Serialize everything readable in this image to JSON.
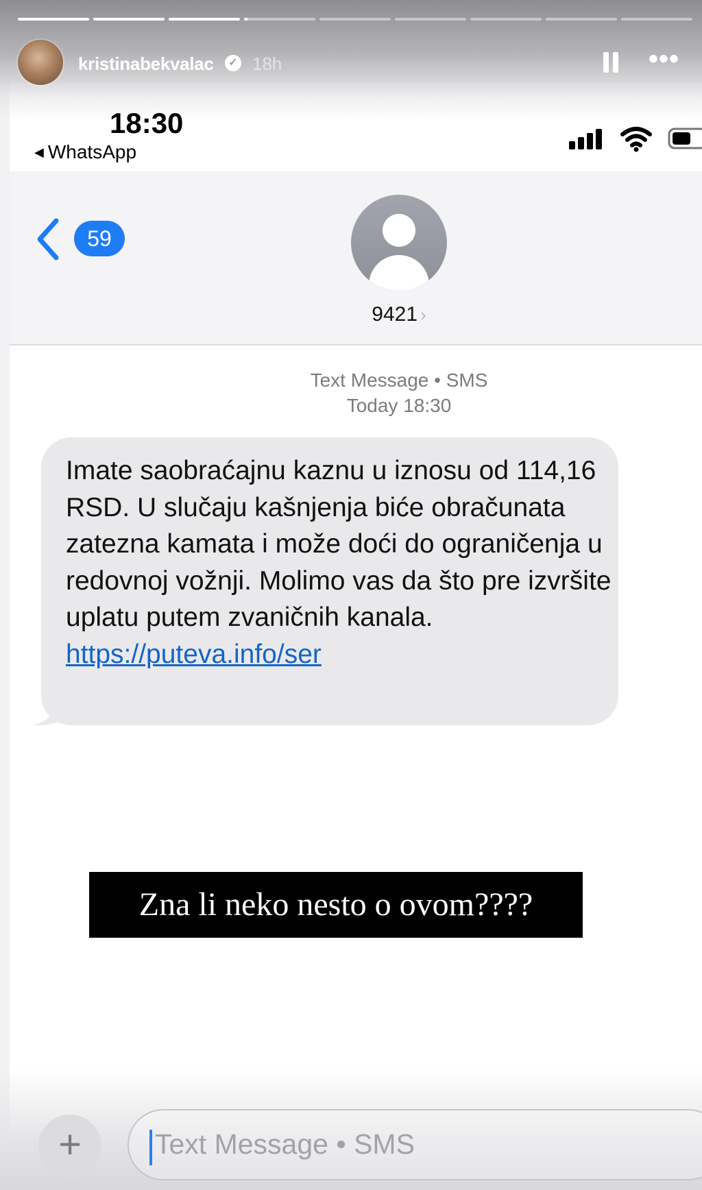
{
  "story": {
    "progress": [
      1,
      1,
      1,
      0.05,
      0,
      0,
      0,
      0,
      0
    ],
    "username": "kristinabekvalac",
    "time_ago": "18h"
  },
  "status_bar": {
    "time": "18:30",
    "back_app": "WhatsApp"
  },
  "nav": {
    "unread_count": "59",
    "contact": "9421"
  },
  "conversation": {
    "service": "Text Message • SMS",
    "timestamp": "Today 18:30",
    "message_text": "Imate saobraćajnu kaznu u iznosu od 114,16 RSD. U slučaju kašnjenja biće obračunata zatezna kamata i može doći do ograničenja u redovnoj vožnji. Molimo vas da što pre izvršite uplatu putem zvaničnih kanala. ",
    "message_link": "https://puteva.info/ser"
  },
  "overlay_caption": "Zna li neko nesto o ovom????",
  "composer": {
    "add_label": "+",
    "placeholder": "Text Message • SMS"
  },
  "colors": {
    "accent": "#1e7cf4",
    "bubble": "#e9e9eb",
    "link": "#1564c8"
  }
}
